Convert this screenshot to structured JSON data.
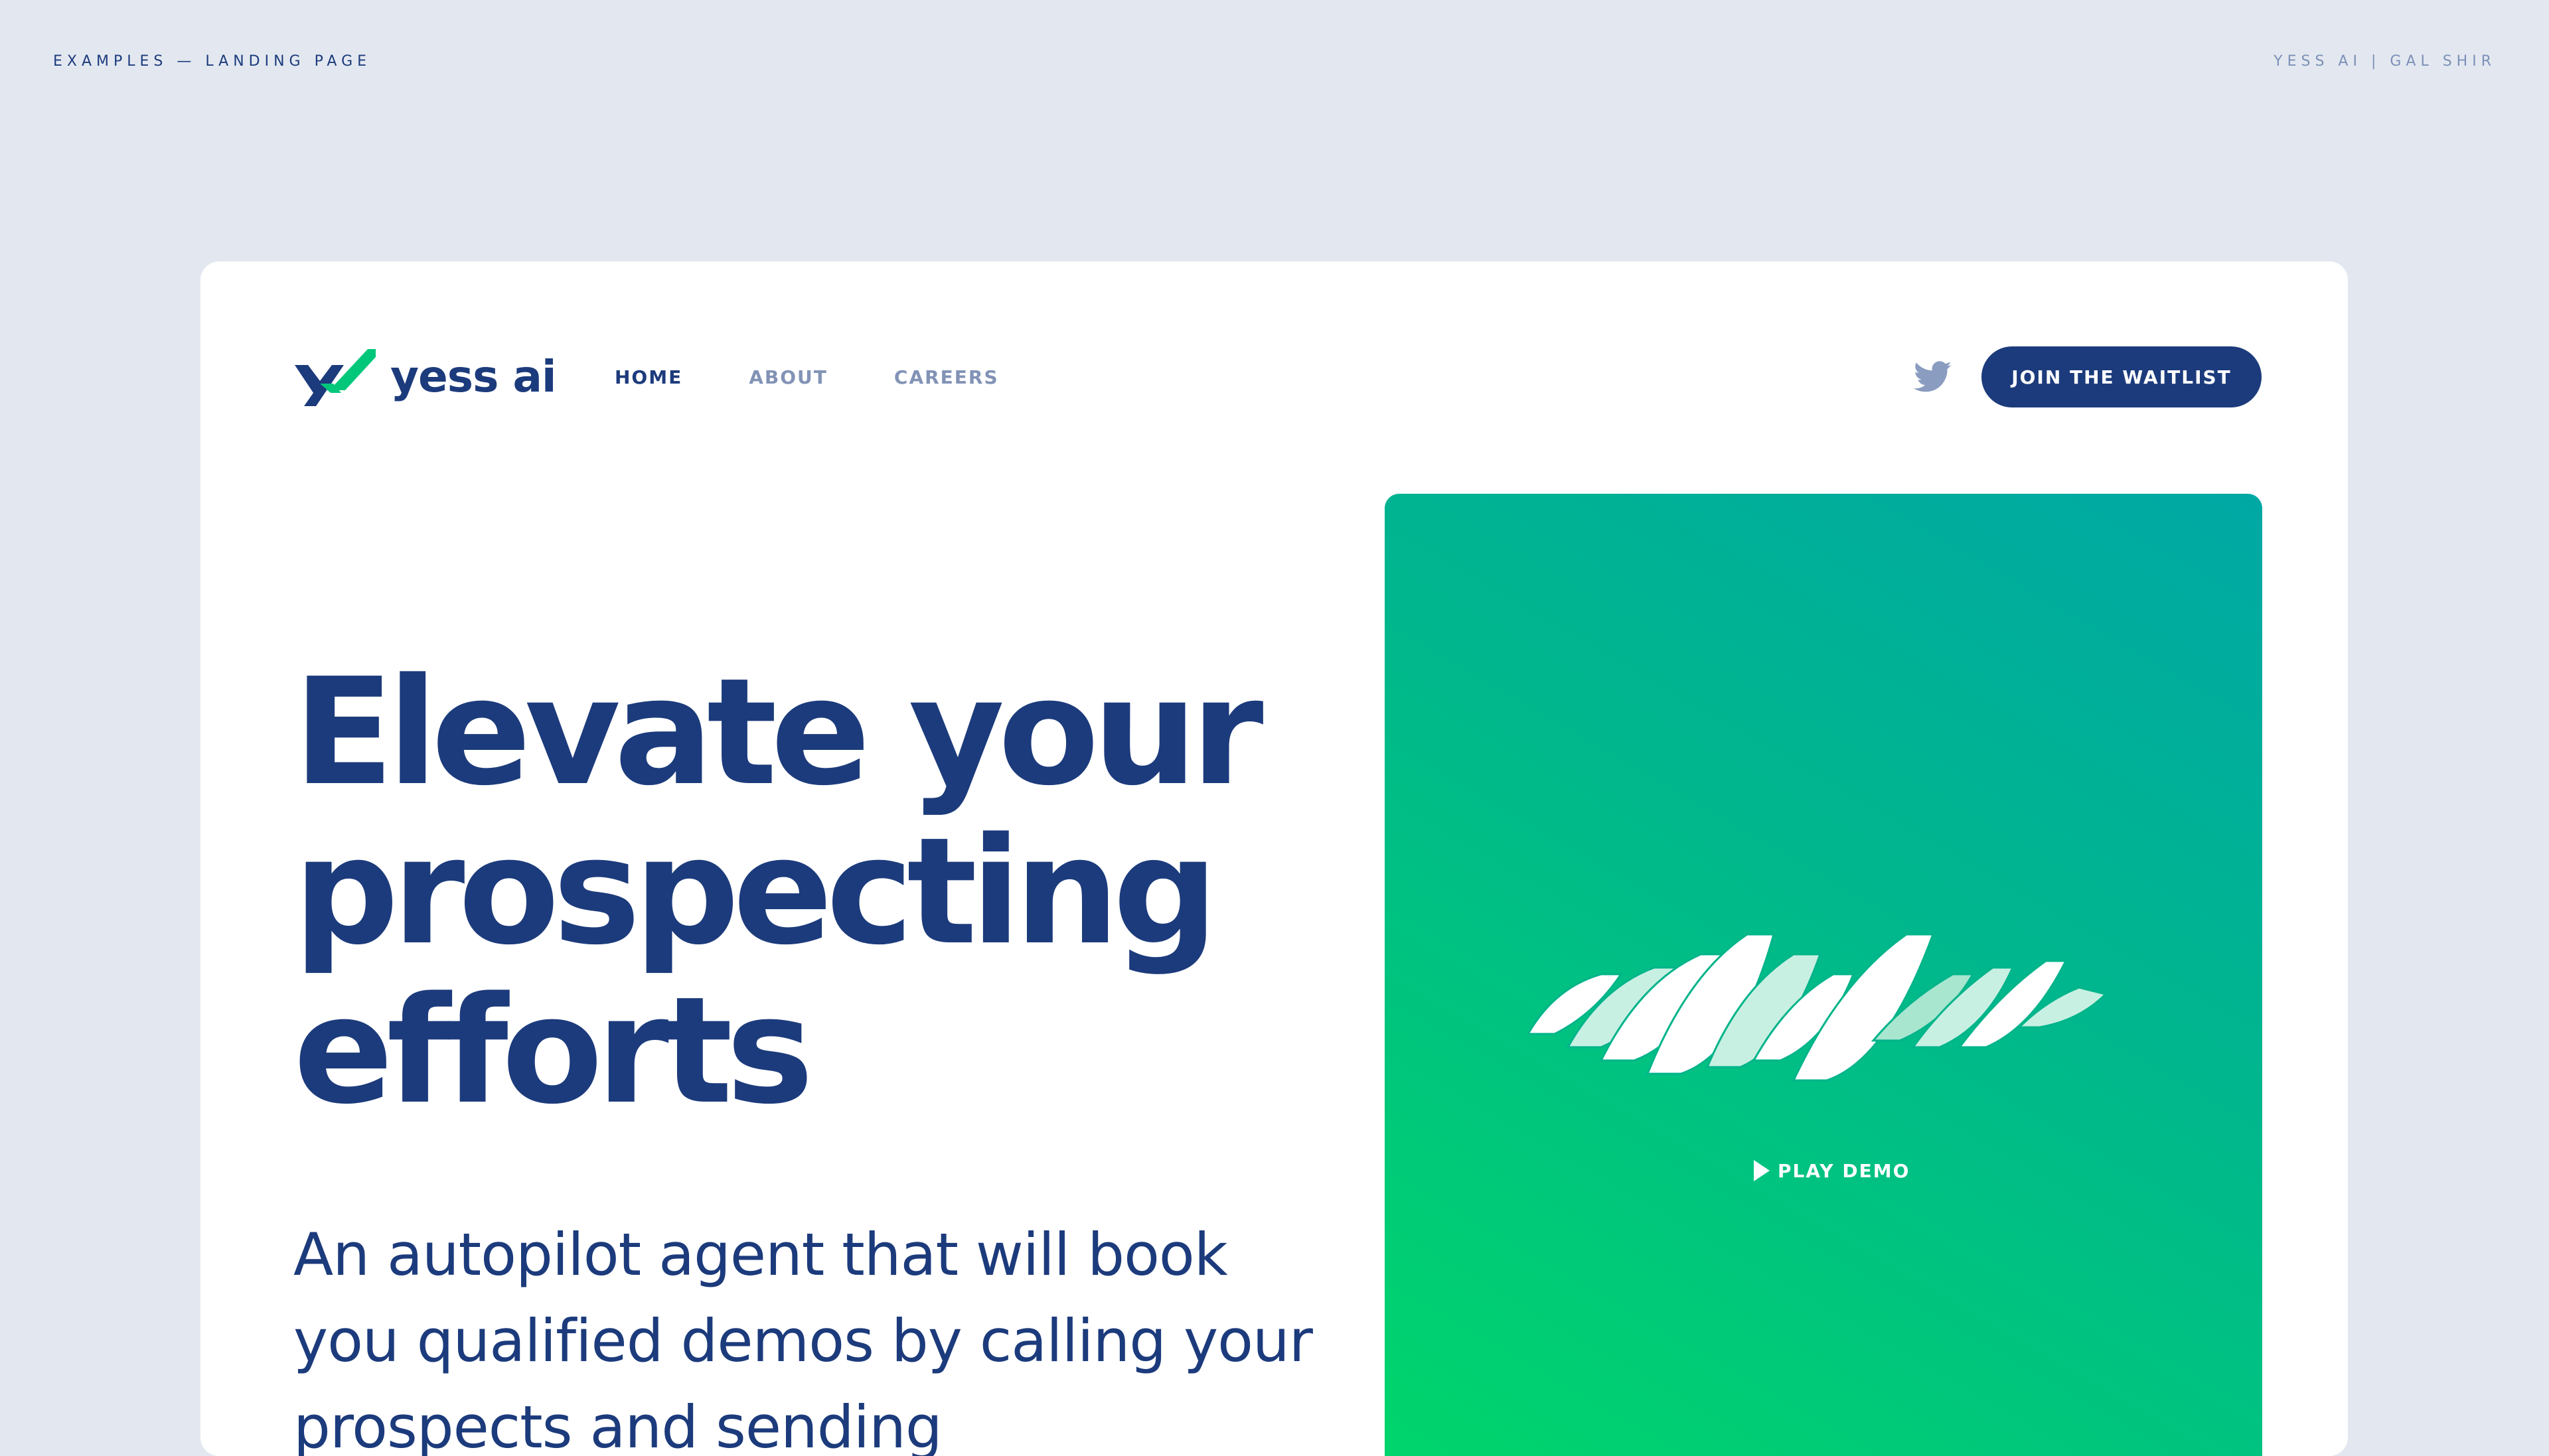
{
  "meta": {
    "left_label": "EXAMPLES — LANDING PAGE",
    "right_label": "YESS AI | GAL SHIR"
  },
  "brand": {
    "name": "yess ai",
    "primary_color": "#1c3b7c",
    "accent_color": "#00c77a"
  },
  "nav": {
    "links": [
      {
        "label": "HOME",
        "active": true
      },
      {
        "label": "ABOUT",
        "active": false
      },
      {
        "label": "CAREERS",
        "active": false
      }
    ],
    "social_icon": "twitter-icon",
    "cta_label": "JOIN THE WAITLIST"
  },
  "hero": {
    "headline": "Elevate your prospecting efforts",
    "subheadline": "An autopilot agent that will book you qualified demos by calling your prospects and sending",
    "media": {
      "play_icon": "play-icon",
      "play_label": "PLAY DEMO",
      "gradient_start": "#00a8a4",
      "gradient_end": "#00d66a"
    }
  }
}
